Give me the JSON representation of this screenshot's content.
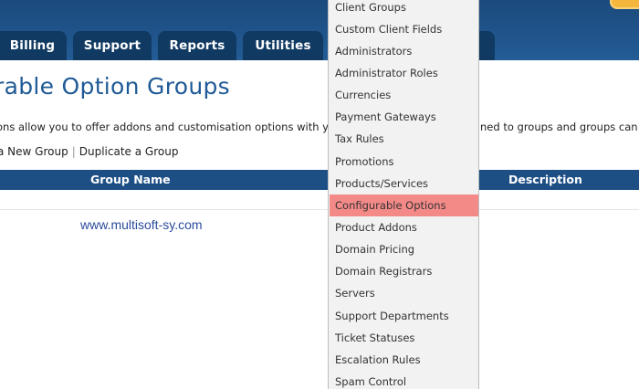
{
  "nav": {
    "tabs": [
      {
        "label": "Billing"
      },
      {
        "label": "Support"
      },
      {
        "label": "Reports"
      },
      {
        "label": "Utilities"
      }
    ]
  },
  "page": {
    "title": "rable Option Groups",
    "intro_left": "ons allow you to offer addons and customisation options with you",
    "intro_right": "ned to groups and groups can th",
    "actions": {
      "create": "a New Group",
      "separator": "|",
      "duplicate": "Duplicate a Group"
    }
  },
  "table": {
    "columns": [
      "Group Name",
      "Description"
    ]
  },
  "watermark": "www.multisoft-sy.com",
  "menu": {
    "items": [
      "Client Groups",
      "Custom Client Fields",
      "Administrators",
      "Administrator Roles",
      "Currencies",
      "Payment Gateways",
      "Tax Rules",
      "Promotions",
      "Products/Services",
      "Configurable Options",
      "Product Addons",
      "Domain Pricing",
      "Domain Registrars",
      "Servers",
      "Support Departments",
      "Ticket Statuses",
      "Escalation Rules",
      "Spam Control"
    ],
    "active_item": "Configurable Options",
    "highlight_color": "#f48a88"
  },
  "colors": {
    "header": "#235c96",
    "tab": "#113a63",
    "title": "#1f5a96",
    "table_header": "#1d4f85"
  }
}
